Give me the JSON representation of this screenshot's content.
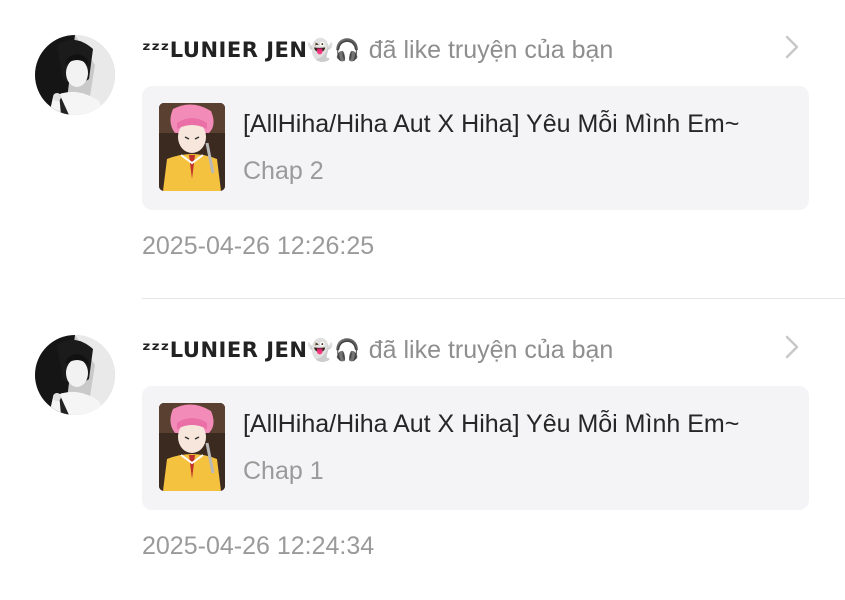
{
  "notifications": [
    {
      "user": {
        "name": "ᶻᶻᶻLUNIER JEN👻🎧",
        "avatar_icon": "avatar-manga-portrait"
      },
      "action": "đã like truyện của bạn",
      "story": {
        "title": "[AllHiha/Hiha Aut X Hiha] Yêu Mỗi Mình Em~",
        "chapter": "Chap 2",
        "cover_icon": "story-cover-pink-hair-character"
      },
      "timestamp": "2025-04-26 12:26:25"
    },
    {
      "user": {
        "name": "ᶻᶻᶻLUNIER JEN👻🎧",
        "avatar_icon": "avatar-manga-portrait"
      },
      "action": "đã like truyện của bạn",
      "story": {
        "title": "[AllHiha/Hiha Aut X Hiha] Yêu Mỗi Mình Em~",
        "chapter": "Chap 1",
        "cover_icon": "story-cover-pink-hair-character"
      },
      "timestamp": "2025-04-26 12:24:34"
    }
  ],
  "icons": {
    "chevron": "chevron-right-icon"
  },
  "colors": {
    "card_background": "#f4f4f6",
    "muted_text": "#9a9a9a",
    "primary_text": "#262626",
    "zzz_blue": "#2f5fb3"
  }
}
